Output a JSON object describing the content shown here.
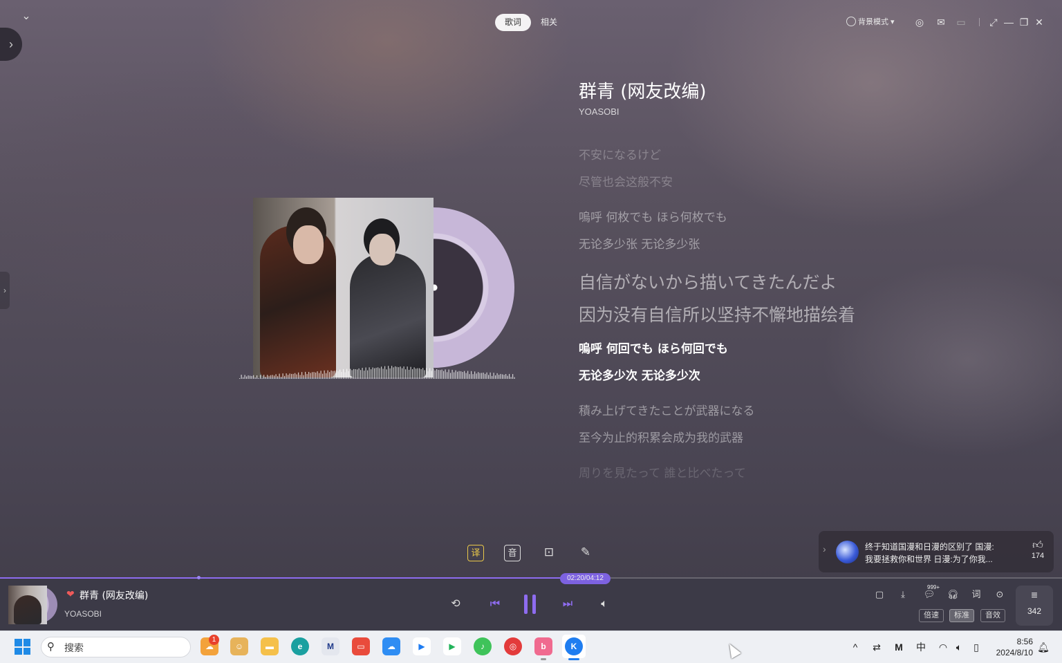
{
  "header": {
    "tabs": [
      {
        "label": "歌词"
      },
      {
        "label": "相关"
      }
    ],
    "bg_mode_label": "背景模式",
    "controls": [
      "target-icon",
      "mail-icon",
      "screen-icon",
      "fullscreen-icon",
      "minimize-icon",
      "restore-icon",
      "close-icon"
    ]
  },
  "song": {
    "title": "群青 (网友改编)",
    "artist": "YOASOBI"
  },
  "lyrics": [
    "不安になるけど",
    "尽管也会这般不安",
    "嗚呼 何枚でも ほら何枚でも",
    "无论多少张 无论多少张",
    "自信がないから描いてきたんだよ",
    "因为没有自信所以坚持不懈地描绘着",
    "嗚呼 何回でも ほら何回でも",
    "无论多少次 无论多少次",
    "積み上げてきたことが武器になる",
    "至今为止的积累会成为我的武器",
    "周りを見たって 誰と比べたって"
  ],
  "lyric_tools": [
    {
      "name": "translate",
      "label": "译"
    },
    {
      "name": "phonetic",
      "label": "音"
    },
    {
      "name": "video",
      "label": ""
    },
    {
      "name": "tools",
      "label": ""
    }
  ],
  "comment": {
    "line1": "终于知道国漫和日漫的区别了 国漫:",
    "line2": "我要拯救你和世界 日漫:为了你我...",
    "likes": "174"
  },
  "progress": {
    "time": "02:20/04:12",
    "fraction": 0.556
  },
  "player": {
    "title": "群青 (网友改编)",
    "artist": "YOASOBI",
    "comment_badge": "999+",
    "lyric_label": "词",
    "speed_label": "倍速",
    "quality_label": "标准",
    "effect_label": "音效",
    "queue_count": "342"
  },
  "taskbar": {
    "search_placeholder": "搜索",
    "weather_badge": "1",
    "apps": [
      "weather",
      "game-app",
      "file-explorer",
      "edge",
      "music-app",
      "huawei-app",
      "cloud-app",
      "player-app",
      "play-store",
      "qq-music",
      "netease-music",
      "bilibili",
      "kugou"
    ],
    "ime": "中",
    "time": "8:56",
    "date": "2024/8/10"
  },
  "colors": {
    "accent": "#8e6cf0",
    "heart": "#ef5a5a",
    "translate_hl": "#e9c84a"
  }
}
